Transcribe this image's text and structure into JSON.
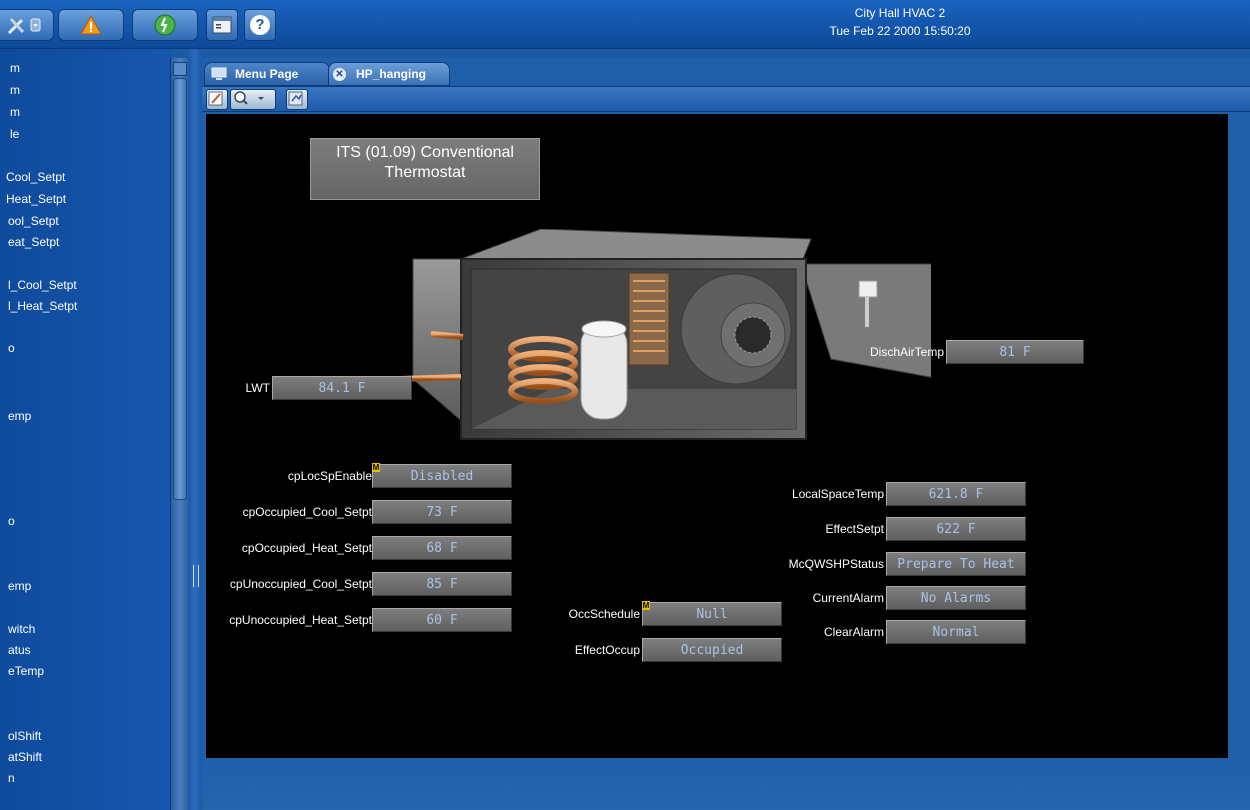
{
  "window": {
    "title": "City Hall HVAC 2",
    "datetime": "Tue Feb 22 2000 15:50:20"
  },
  "toolbar": {
    "icons": [
      "tools-icon",
      "warning-icon",
      "network-run-icon",
      "window-icon",
      "help-icon"
    ],
    "help_label": "?"
  },
  "sidebar": {
    "items": [
      "m",
      "m",
      "m",
      "le",
      "Cool_Setpt",
      "Heat_Setpt",
      "ool_Setpt",
      "eat_Setpt",
      "l_Cool_Setpt",
      "l_Heat_Setpt",
      "o",
      "emp",
      "o",
      "emp",
      "witch",
      "atus",
      "eTemp",
      "olShift",
      "atShift",
      "n"
    ]
  },
  "tabs": [
    {
      "label": "Menu Page",
      "icon": "monitor-icon"
    },
    {
      "label": "HP_hanging",
      "icon": "close-icon"
    }
  ],
  "canvas": {
    "title_line1": "ITS (01.09)  Conventional",
    "title_line2": "Thermostat",
    "points": {
      "lwt": {
        "label": "LWT",
        "value": "84.1 F"
      },
      "disch_air_temp": {
        "label": "DischAirTemp",
        "value": "81 F"
      },
      "cp_loc_sp_enable": {
        "label": "cpLocSpEnable",
        "value": "Disabled",
        "flag": "M"
      },
      "cp_occ_cool": {
        "label": "cpOccupied_Cool_Setpt",
        "value": "73 F"
      },
      "cp_occ_heat": {
        "label": "cpOccupied_Heat_Setpt",
        "value": "68 F"
      },
      "cp_unocc_cool": {
        "label": "cpUnoccupied_Cool_Setpt",
        "value": "85 F"
      },
      "cp_unocc_heat": {
        "label": "cpUnoccupied_Heat_Setpt",
        "value": "60 F"
      },
      "occ_schedule": {
        "label": "OccSchedule",
        "value": "Null",
        "flag": "M"
      },
      "effect_occup": {
        "label": "EffectOccup",
        "value": "Occupied"
      },
      "local_space_temp": {
        "label": "LocalSpaceTemp",
        "value": "621.8 F"
      },
      "effect_setpt": {
        "label": "EffectSetpt",
        "value": "622 F"
      },
      "mcq_status": {
        "label": "McQWSHPStatus",
        "value": "Prepare To Heat"
      },
      "current_alarm": {
        "label": "CurrentAlarm",
        "value": "No Alarms"
      },
      "clear_alarm": {
        "label": "ClearAlarm",
        "value": "Normal"
      }
    }
  },
  "colors": {
    "background": "#1d5aa3",
    "canvas": "#000000",
    "value_text": "#a9c2e4",
    "flag": "#e8c000"
  }
}
